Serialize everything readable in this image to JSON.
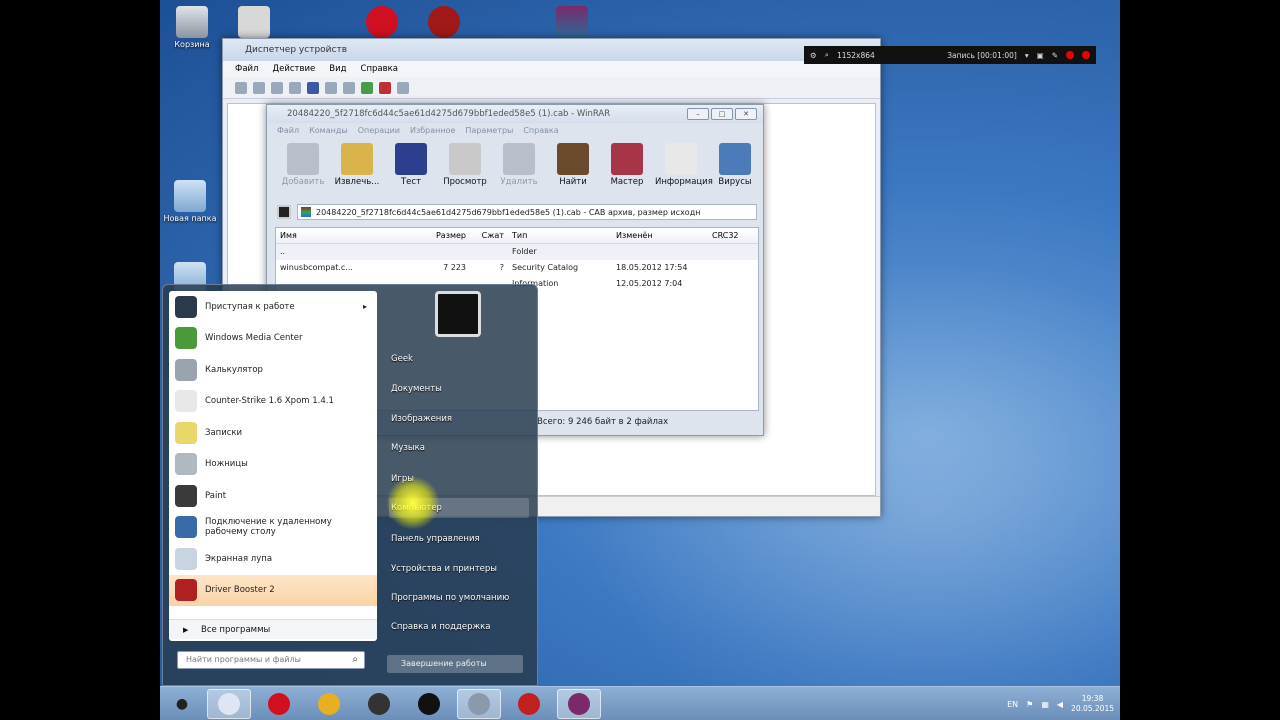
{
  "desktop": {
    "icons": [
      {
        "label": "Корзина"
      },
      {
        "label": "Новая папка"
      }
    ]
  },
  "device_manager": {
    "title": "Диспетчер устройств",
    "menu": [
      "Файл",
      "Действие",
      "Вид",
      "Справка"
    ]
  },
  "winrar": {
    "title": "20484220_5f2718fc6d44c5ae61d4275d679bbf1eded58e5 (1).cab - WinRAR",
    "menu": [
      "Файл",
      "Команды",
      "Операции",
      "Избранное",
      "Параметры",
      "Справка"
    ],
    "toolbar": [
      {
        "label": "Добавить",
        "disabled": true,
        "color": "#b8bfca"
      },
      {
        "label": "Извлечь...",
        "disabled": false,
        "color": "#d8b44a"
      },
      {
        "label": "Тест",
        "disabled": false,
        "color": "#2c3f8e"
      },
      {
        "label": "Просмотр",
        "disabled": false,
        "color": "#c9c9c9"
      },
      {
        "label": "Удалить",
        "disabled": true,
        "color": "#b8bfca"
      },
      {
        "label": "Найти",
        "disabled": false,
        "color": "#6a4a2a"
      },
      {
        "label": "Мастер",
        "disabled": false,
        "color": "#a8344a"
      },
      {
        "label": "Информация",
        "disabled": false,
        "color": "#e8e8e8"
      },
      {
        "label": "Вирусы",
        "disabled": false,
        "color": "#4a7ab8"
      }
    ],
    "path": "20484220_5f2718fc6d44c5ae61d4275d679bbf1eded58e5 (1).cab - CAB архив, размер исходн",
    "columns": {
      "name": "Имя",
      "size": "Размер",
      "packed": "Сжат",
      "type": "Тип",
      "modified": "Изменён",
      "crc": "CRC32"
    },
    "rows": [
      {
        "name": "..",
        "size": "",
        "packed": "",
        "type": "Folder",
        "modified": "",
        "crc": ""
      },
      {
        "name": "winusbcompat.c...",
        "size": "7 223",
        "packed": "?",
        "type": "Security Catalog",
        "modified": "18.05.2012 17:54",
        "crc": ""
      },
      {
        "name": "",
        "size": "",
        "packed": "",
        "type": "Information",
        "modified": "12.05.2012 7:04",
        "crc": ""
      }
    ],
    "status": "Всего: 9 246 байт в 2 файлах"
  },
  "recorder": {
    "resolution": "1152x864",
    "record": "Запись [00:01:00]"
  },
  "start_menu": {
    "programs": [
      {
        "label": "Приступая к работе",
        "color": "#2a3a4a",
        "arrow": "▸",
        "highlight": false
      },
      {
        "label": "Windows Media Center",
        "color": "#4a9a3a",
        "arrow": "",
        "highlight": false
      },
      {
        "label": "Калькулятор",
        "color": "#9aa4ae",
        "arrow": "",
        "highlight": false
      },
      {
        "label": "Counter-Strike 1.6 Xpom 1.4.1",
        "color": "#e8e8e8",
        "arrow": "",
        "highlight": false
      },
      {
        "label": "Записки",
        "color": "#e8d86a",
        "arrow": "",
        "highlight": false
      },
      {
        "label": "Ножницы",
        "color": "#b0b8c0",
        "arrow": "",
        "highlight": false
      },
      {
        "label": "Paint",
        "color": "#3a3a3a",
        "arrow": "",
        "highlight": false
      },
      {
        "label": "Подключение к удаленному рабочему столу",
        "color": "#3a6aa8",
        "arrow": "",
        "highlight": false
      },
      {
        "label": "Экранная лупа",
        "color": "#c8d4e0",
        "arrow": "",
        "highlight": false
      },
      {
        "label": "Driver Booster 2",
        "color": "#b02020",
        "arrow": "",
        "highlight": true
      }
    ],
    "all_programs": "Все программы",
    "search_placeholder": "Найти программы и файлы",
    "right_items": [
      {
        "label": "Geek",
        "highlight": false
      },
      {
        "label": "Документы",
        "highlight": false
      },
      {
        "label": "Изображения",
        "highlight": false
      },
      {
        "label": "Музыка",
        "highlight": false
      },
      {
        "label": "Игры",
        "highlight": false
      },
      {
        "label": "Компьютер",
        "highlight": true
      },
      {
        "label": "Панель управления",
        "highlight": false
      },
      {
        "label": "Устройства и принтеры",
        "highlight": false
      },
      {
        "label": "Программы по умолчанию",
        "highlight": false
      },
      {
        "label": "Справка и поддержка",
        "highlight": false
      }
    ],
    "shutdown": "Завершение работы"
  },
  "taskbar": {
    "buttons": [
      {
        "name": "finder-icon",
        "color": "#dde6f2",
        "active": true
      },
      {
        "name": "opera-icon",
        "color": "#d01020",
        "active": false
      },
      {
        "name": "chrome-icon",
        "color": "#e8b020",
        "active": false
      },
      {
        "name": "phone-icon",
        "color": "#333333",
        "active": false
      },
      {
        "name": "record-icon",
        "color": "#111111",
        "active": false
      },
      {
        "name": "device-manager-icon",
        "color": "#8a9aaa",
        "active": true
      },
      {
        "name": "car-icon",
        "color": "#c02020",
        "active": false
      },
      {
        "name": "winrar-icon",
        "color": "#7a2a6a",
        "active": true
      }
    ],
    "lang": "EN",
    "time": "19:38",
    "date": "20.05.2015"
  }
}
